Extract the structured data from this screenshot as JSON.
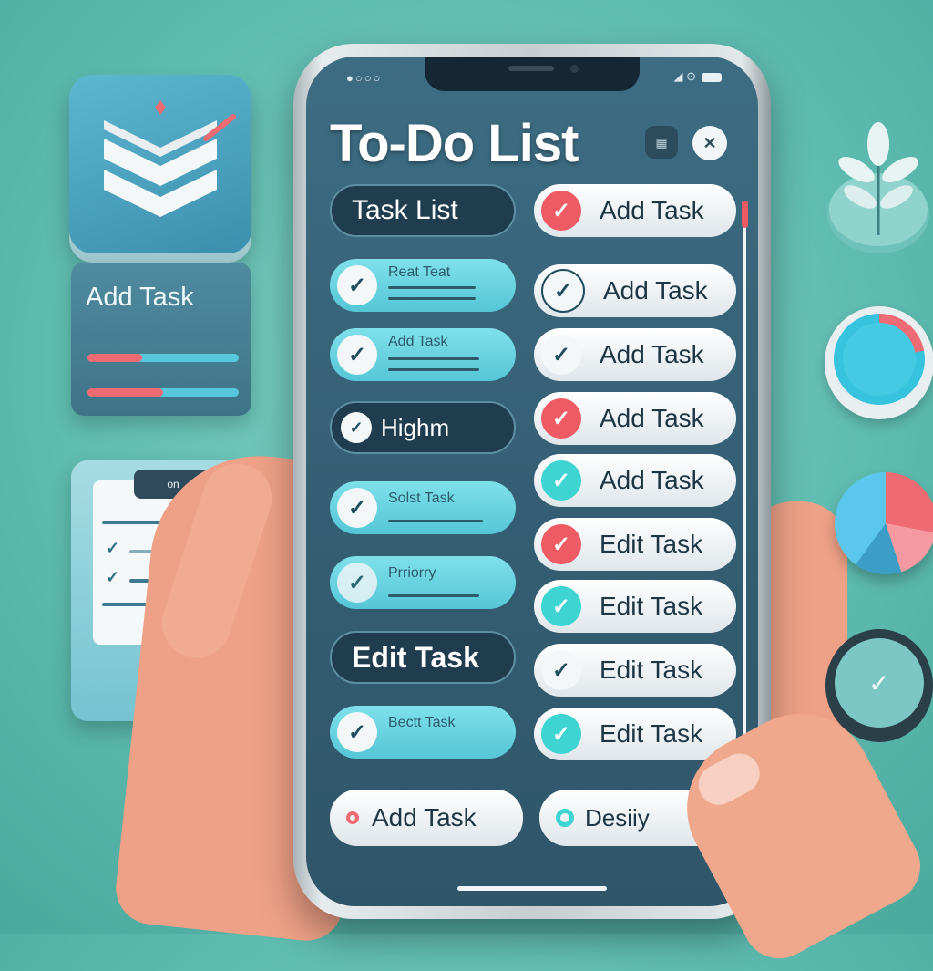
{
  "left_panel": {
    "side_card_title": "Add Task",
    "progress": [
      0.36,
      0.5
    ],
    "clip_tab": "on"
  },
  "status_bar": {
    "left": "●○○○",
    "right": "◢ ⊙"
  },
  "app": {
    "title": "To-Do List"
  },
  "left_column": [
    {
      "label": "Task List",
      "style": "dark"
    },
    {
      "label": "Reat Teat",
      "style": "light"
    },
    {
      "label": "Add Task",
      "style": "light"
    },
    {
      "label": "Highm",
      "style": "dark"
    },
    {
      "label": "Solst Task",
      "style": "light"
    },
    {
      "label": "Prriorry",
      "style": "light"
    },
    {
      "label": "Edit Task",
      "style": "dark"
    },
    {
      "label": "Bectt Task",
      "style": "light"
    }
  ],
  "right_column": [
    {
      "label": "Add Task",
      "check": "red"
    },
    {
      "label": "Add Task",
      "check": "white"
    },
    {
      "label": "Add Task",
      "check": "white"
    },
    {
      "label": "Add Task",
      "check": "red"
    },
    {
      "label": "Add Task",
      "check": "teal"
    },
    {
      "label": "Edit Task",
      "check": "red"
    },
    {
      "label": "Edit Task",
      "check": "teal"
    },
    {
      "label": "Edit Task",
      "check": "white"
    },
    {
      "label": "Edit Task",
      "check": "teal"
    }
  ],
  "bottom_buttons": {
    "add": "Add Task",
    "priority": "Desiiy"
  },
  "colors": {
    "accent_red": "#ef5b64",
    "accent_teal": "#3dd4d2",
    "screen_bg": "#355f74"
  }
}
